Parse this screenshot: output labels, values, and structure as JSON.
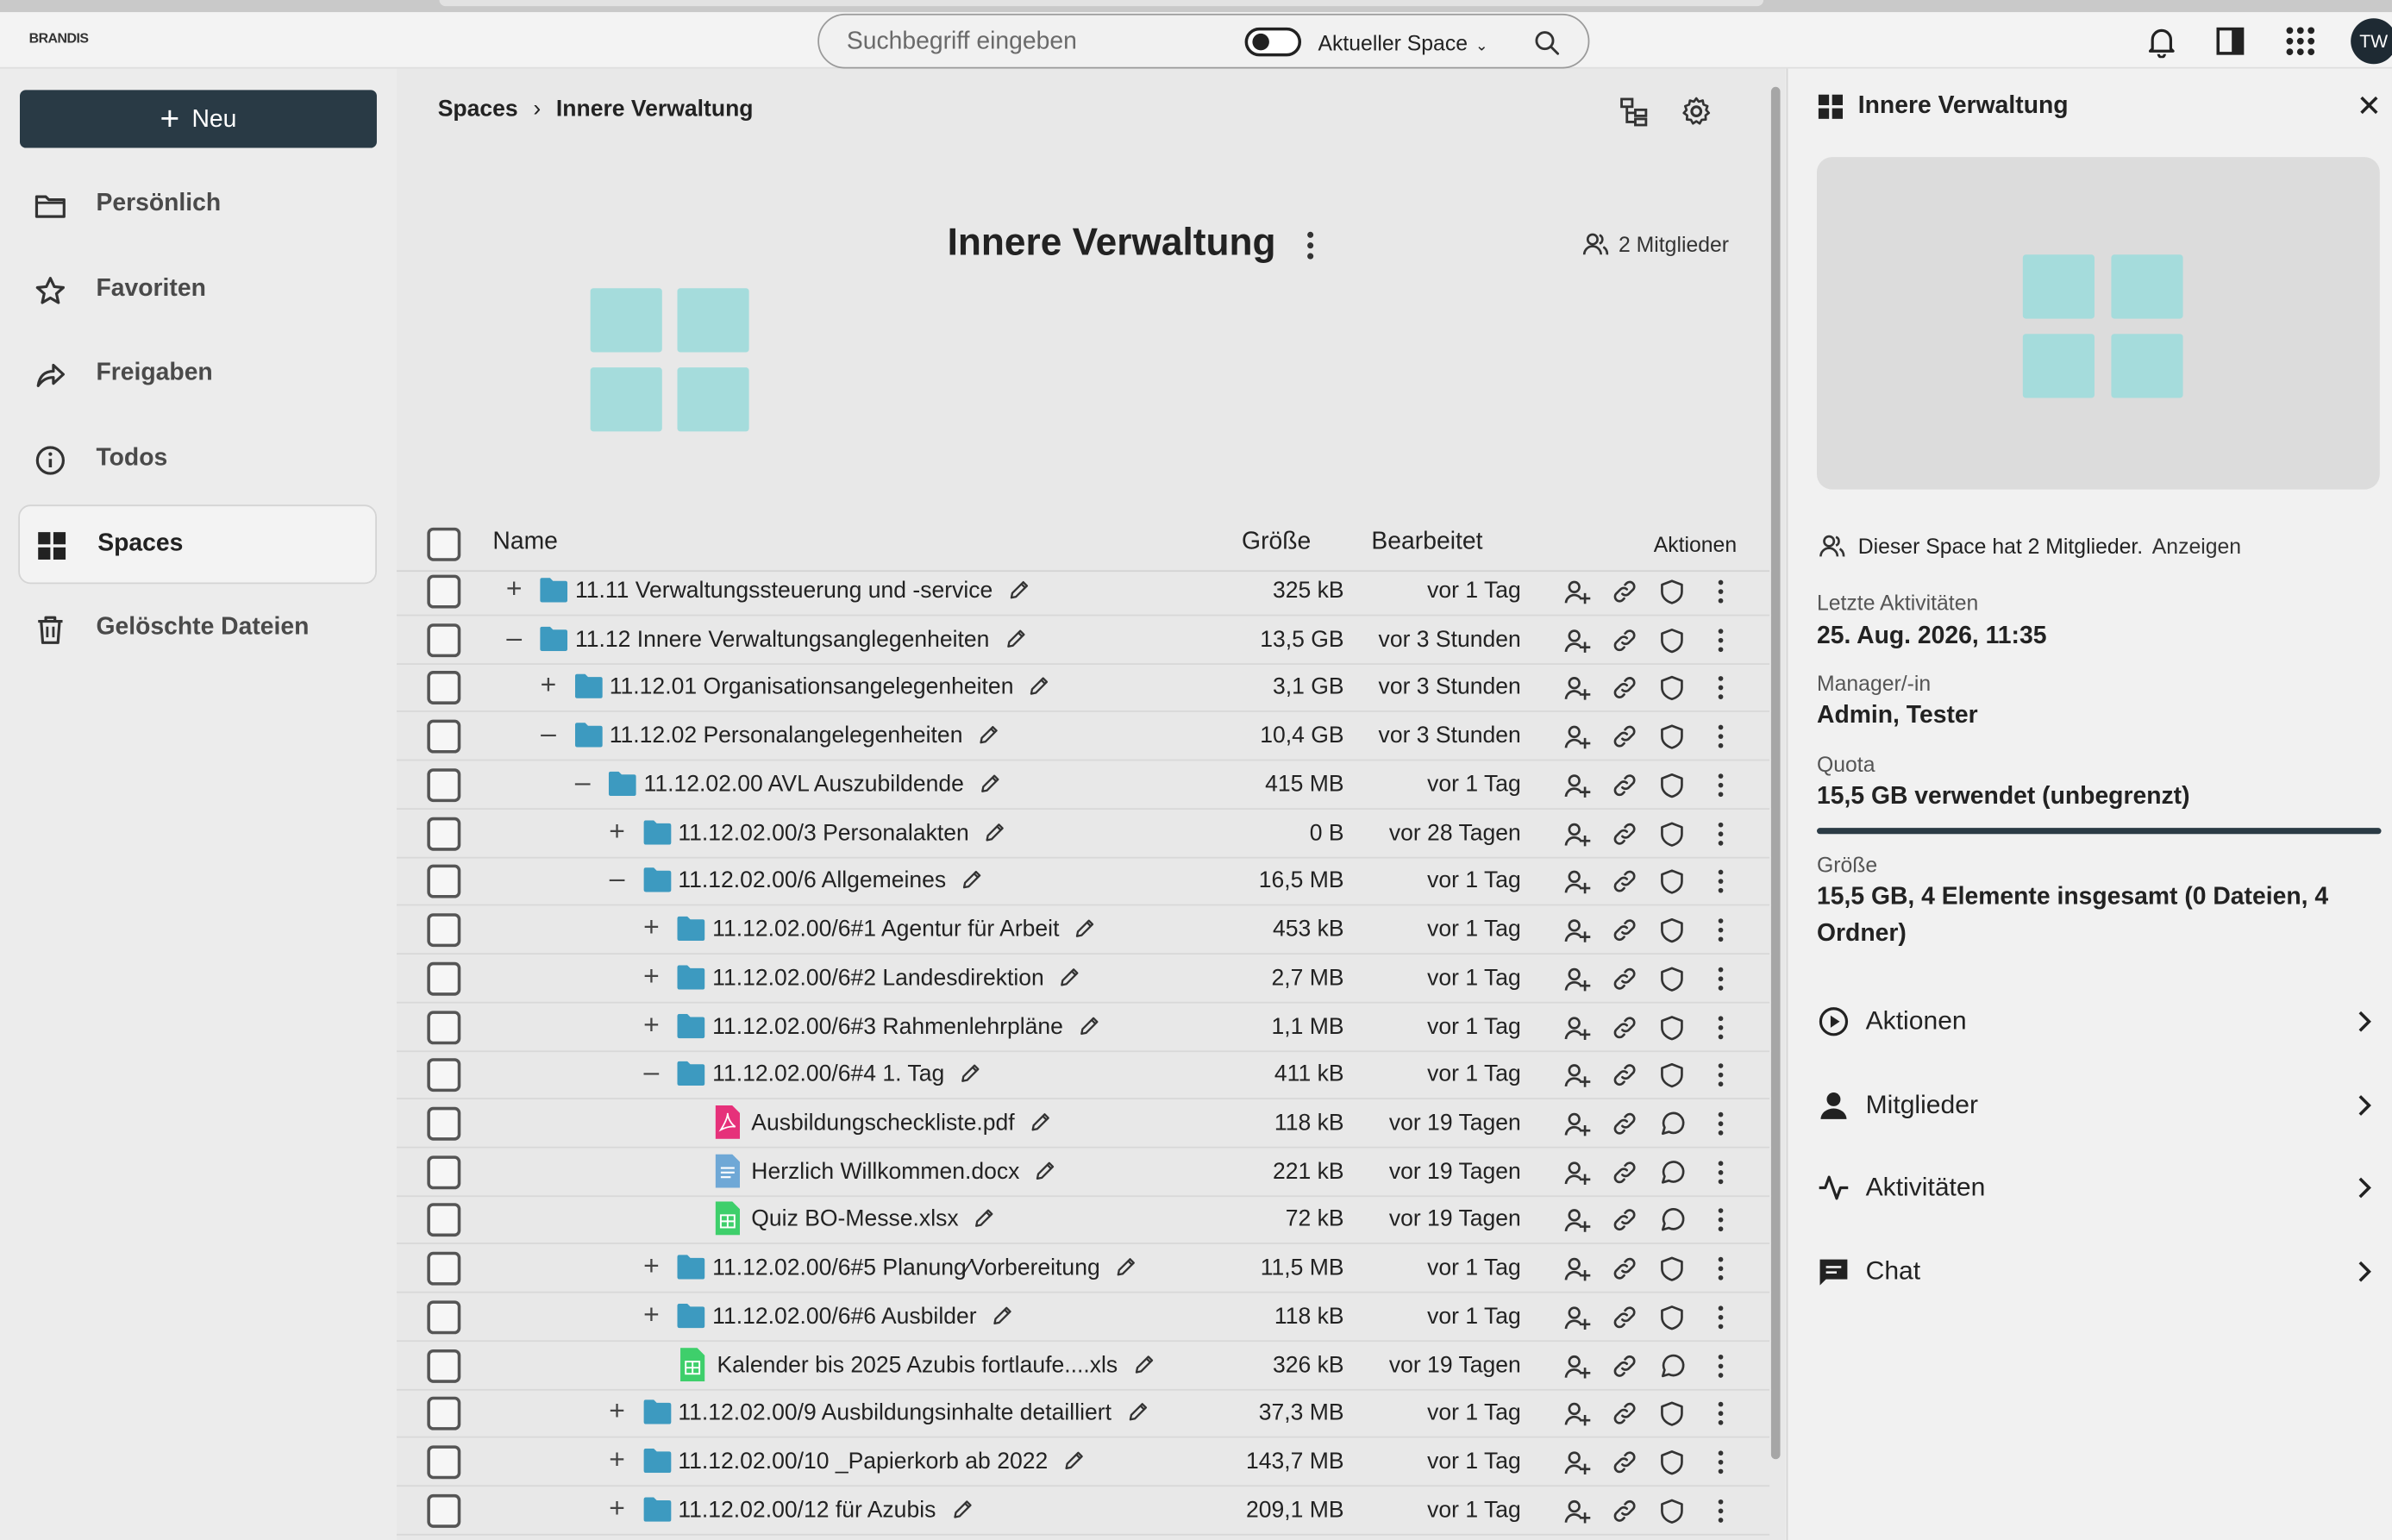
{
  "app": {
    "logo": "BRANDIS"
  },
  "search": {
    "placeholder": "Suchbegriff eingeben",
    "scope": "Aktueller Space"
  },
  "user": {
    "initials": "TW"
  },
  "sidebar": {
    "new_label": "Neu",
    "items": [
      {
        "label": "Persönlich",
        "icon": "folder-icon"
      },
      {
        "label": "Favoriten",
        "icon": "star-icon"
      },
      {
        "label": "Freigaben",
        "icon": "share-icon"
      },
      {
        "label": "Todos",
        "icon": "info-icon"
      },
      {
        "label": "Spaces",
        "icon": "grid-icon",
        "active": true
      },
      {
        "label": "Gelöschte Dateien",
        "icon": "trash-icon"
      }
    ]
  },
  "breadcrumb": {
    "root": "Spaces",
    "current": "Innere Verwaltung"
  },
  "space": {
    "title": "Innere Verwaltung",
    "members": "2 Mitglieder"
  },
  "table": {
    "headers": {
      "name": "Name",
      "size": "Größe",
      "edited": "Bearbeitet",
      "actions": "Aktionen"
    },
    "rows": [
      {
        "level": 0,
        "exp": "+",
        "type": "folder",
        "name": "11.11 Verwaltungssteuerung und -service",
        "size": "325 kB",
        "edited": "vor 1 Tag"
      },
      {
        "level": 0,
        "exp": "–",
        "type": "folder",
        "name": "11.12 Innere Verwaltungsanglegenheiten",
        "size": "13,5 GB",
        "edited": "vor 3 Stunden"
      },
      {
        "level": 1,
        "exp": "+",
        "type": "folder",
        "name": "11.12.01 Organisationsangelegenheiten",
        "size": "3,1 GB",
        "edited": "vor 3 Stunden"
      },
      {
        "level": 1,
        "exp": "–",
        "type": "folder",
        "name": "11.12.02 Personalangelegenheiten",
        "size": "10,4 GB",
        "edited": "vor 3 Stunden"
      },
      {
        "level": 2,
        "exp": "–",
        "type": "folder",
        "name": "11.12.02.00 AVL Auszubildende",
        "size": "415 MB",
        "edited": "vor 1 Tag"
      },
      {
        "level": 3,
        "exp": "+",
        "type": "folder",
        "name": "11.12.02.00/3 Personalakten",
        "size": "0 B",
        "edited": "vor 28 Tagen"
      },
      {
        "level": 3,
        "exp": "–",
        "type": "folder",
        "name": "11.12.02.00/6 Allgemeines",
        "size": "16,5 MB",
        "edited": "vor 1 Tag"
      },
      {
        "level": 4,
        "exp": "+",
        "type": "folder",
        "name": "11.12.02.00/6#1 Agentur für Arbeit",
        "size": "453 kB",
        "edited": "vor 1 Tag"
      },
      {
        "level": 4,
        "exp": "+",
        "type": "folder",
        "name": "11.12.02.00/6#2 Landesdirektion",
        "size": "2,7 MB",
        "edited": "vor 1 Tag"
      },
      {
        "level": 4,
        "exp": "+",
        "type": "folder",
        "name": "11.12.02.00/6#3 Rahmenlehrpläne",
        "size": "1,1 MB",
        "edited": "vor 1 Tag"
      },
      {
        "level": 4,
        "exp": "–",
        "type": "folder",
        "name": "11.12.02.00/6#4 1. Tag",
        "size": "411 kB",
        "edited": "vor 1 Tag"
      },
      {
        "level": 5,
        "exp": "",
        "type": "pdf",
        "name": "Ausbildungscheckliste.pdf",
        "size": "118 kB",
        "edited": "vor 19 Tagen"
      },
      {
        "level": 5,
        "exp": "",
        "type": "docx",
        "name": "Herzlich Willkommen.docx",
        "size": "221 kB",
        "edited": "vor 19 Tagen"
      },
      {
        "level": 5,
        "exp": "",
        "type": "xlsx",
        "name": "Quiz BO-Messe.xlsx",
        "size": "72 kB",
        "edited": "vor 19 Tagen"
      },
      {
        "level": 4,
        "exp": "+",
        "type": "folder",
        "name": "11.12.02.00/6#5 Planung⁄Vorbereitung",
        "size": "11,5 MB",
        "edited": "vor 1 Tag"
      },
      {
        "level": 4,
        "exp": "+",
        "type": "folder",
        "name": "11.12.02.00/6#6 Ausbilder",
        "size": "118 kB",
        "edited": "vor 1 Tag"
      },
      {
        "level": 4,
        "exp": "",
        "type": "xlsx",
        "name": "Kalender bis 2025 Azubis fortlaufe....xls",
        "size": "326 kB",
        "edited": "vor 19 Tagen"
      },
      {
        "level": 3,
        "exp": "+",
        "type": "folder",
        "name": "11.12.02.00/9 Ausbildungsinhalte detailliert",
        "size": "37,3 MB",
        "edited": "vor 1 Tag"
      },
      {
        "level": 3,
        "exp": "+",
        "type": "folder",
        "name": "11.12.02.00/10 _Papierkorb ab 2022",
        "size": "143,7 MB",
        "edited": "vor 1 Tag"
      },
      {
        "level": 3,
        "exp": "+",
        "type": "folder",
        "name": "11.12.02.00/12 für Azubis",
        "size": "209,1 MB",
        "edited": "vor 1 Tag"
      }
    ]
  },
  "panel": {
    "title": "Innere Verwaltung",
    "members_text": "Dieser Space hat 2 Mitglieder.",
    "members_link": "Anzeigen",
    "last_activity_label": "Letzte Aktivitäten",
    "last_activity": "25. Aug. 2026, 11:35",
    "manager_label": "Manager/-in",
    "manager": "Admin, Tester",
    "quota_label": "Quota",
    "quota": "15,5 GB verwendet (unbegrenzt)",
    "size_label": "Größe",
    "size": "15,5 GB, 4 Elemente insgesamt (0 Dateien, 4 Ordner)",
    "sections": [
      "Aktionen",
      "Mitglieder",
      "Aktivitäten",
      "Chat"
    ]
  },
  "colors": {
    "accent": "#293a45",
    "folder": "#3d9ac0",
    "pdf": "#e6317a",
    "docx": "#6fa8d6",
    "xlsx": "#3ecf6b",
    "space_tile": "#a5dcdc"
  }
}
